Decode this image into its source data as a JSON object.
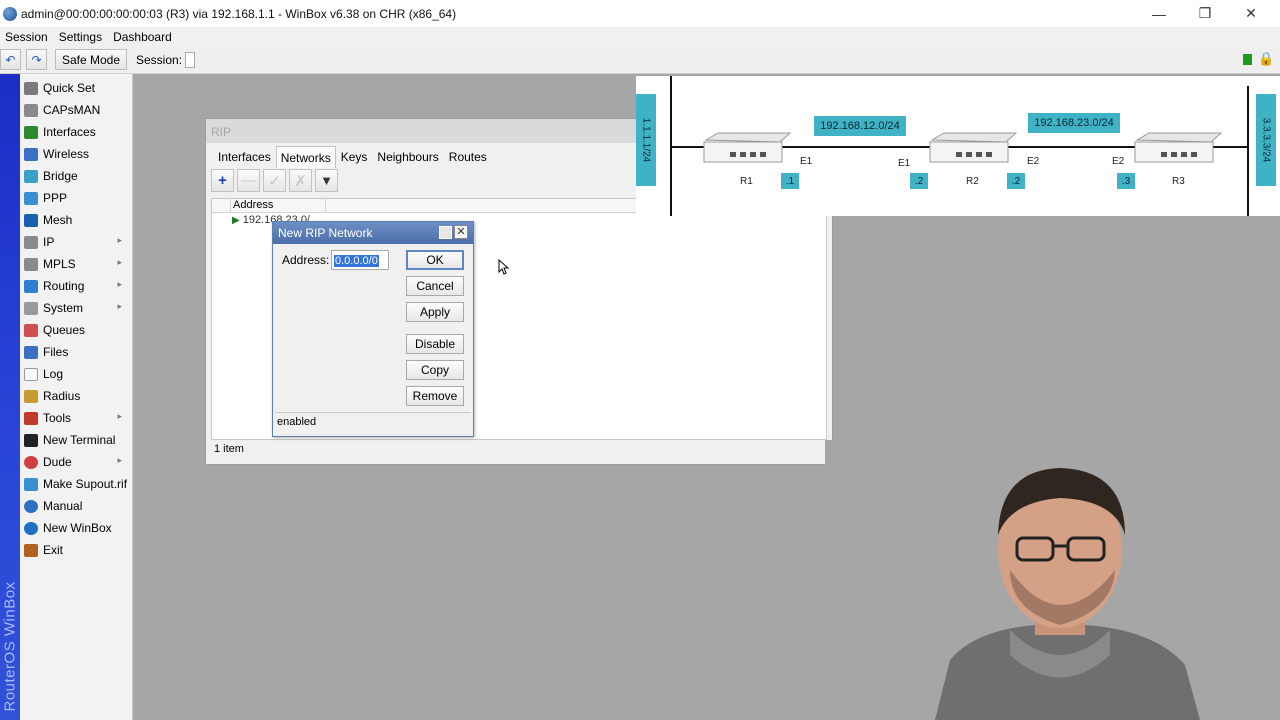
{
  "window": {
    "title": "admin@00:00:00:00:00:03 (R3) via 192.168.1.1 - WinBox v6.38 on CHR (x86_64)",
    "controls": [
      "minimize",
      "restore",
      "close"
    ]
  },
  "menu": [
    "Session",
    "Settings",
    "Dashboard"
  ],
  "toolbar": {
    "undo_icon": "undo-icon",
    "redo_icon": "redo-icon",
    "safe_mode": "Safe Mode",
    "session_label": "Session:"
  },
  "brand": "RouterOS WinBox",
  "sidebar": {
    "items": [
      {
        "label": "Quick Set",
        "icon": "quick-set-icon",
        "color": "#7a7a7a",
        "submenu": false
      },
      {
        "label": "CAPsMAN",
        "icon": "capsman-icon",
        "color": "#8a8a8a",
        "submenu": false
      },
      {
        "label": "Interfaces",
        "icon": "interfaces-icon",
        "color": "#2f8a2f",
        "submenu": false
      },
      {
        "label": "Wireless",
        "icon": "wireless-icon",
        "color": "#3a6fc4",
        "submenu": false
      },
      {
        "label": "Bridge",
        "icon": "bridge-icon",
        "color": "#3aa0c8",
        "submenu": false
      },
      {
        "label": "PPP",
        "icon": "ppp-icon",
        "color": "#3a8fd4",
        "submenu": false
      },
      {
        "label": "Mesh",
        "icon": "mesh-icon",
        "color": "#1b5fb0",
        "submenu": false
      },
      {
        "label": "IP",
        "icon": "ip-icon",
        "color": "#8a8a8a",
        "submenu": true
      },
      {
        "label": "MPLS",
        "icon": "mpls-icon",
        "color": "#8a8a8a",
        "submenu": true
      },
      {
        "label": "Routing",
        "icon": "routing-icon",
        "color": "#2f7fd0",
        "submenu": true
      },
      {
        "label": "System",
        "icon": "system-icon",
        "color": "#9a9a9a",
        "submenu": true
      },
      {
        "label": "Queues",
        "icon": "queues-icon",
        "color": "#d05050",
        "submenu": false
      },
      {
        "label": "Files",
        "icon": "files-icon",
        "color": "#3a6fc4",
        "submenu": false
      },
      {
        "label": "Log",
        "icon": "log-icon",
        "color": "#f2f2f2",
        "submenu": false
      },
      {
        "label": "Radius",
        "icon": "radius-icon",
        "color": "#c89b30",
        "submenu": false
      },
      {
        "label": "Tools",
        "icon": "tools-icon",
        "color": "#c0392b",
        "submenu": true
      },
      {
        "label": "New Terminal",
        "icon": "terminal-icon",
        "color": "#222222",
        "submenu": false
      },
      {
        "label": "Dude",
        "icon": "dude-icon",
        "color": "#d04040",
        "submenu": true
      },
      {
        "label": "Make Supout.rif",
        "icon": "supout-icon",
        "color": "#3a8fd4",
        "submenu": false
      },
      {
        "label": "Manual",
        "icon": "manual-icon",
        "color": "#2f6fc4",
        "submenu": false
      },
      {
        "label": "New WinBox",
        "icon": "winbox-icon",
        "color": "#1f6fc4",
        "submenu": false
      },
      {
        "label": "Exit",
        "icon": "exit-icon",
        "color": "#b06020",
        "submenu": false
      }
    ]
  },
  "rip": {
    "title": "RIP",
    "tabs": [
      "Interfaces",
      "Networks",
      "Keys",
      "Neighbours",
      "Routes"
    ],
    "active_tab": "Networks",
    "column": "Address",
    "row": "192.168.23.0/",
    "status": "1 item"
  },
  "dialog": {
    "title": "New RIP Network",
    "address_label": "Address:",
    "address_value": "0.0.0.0/0",
    "buttons": [
      "OK",
      "Cancel",
      "Apply",
      "Disable",
      "Copy",
      "Remove"
    ],
    "status": "enabled"
  },
  "topology": {
    "left_net": "1.1.1.1/24",
    "right_net": "3.3.3.3/24",
    "net12": "192.168.12.0/24",
    "net23": "192.168.23.0/24",
    "routers": [
      "R1",
      "R2",
      "R3"
    ],
    "ifaces": {
      "r1_e1": "E1",
      "r2_e1": "E1",
      "r2_e2": "E2",
      "r3_e2": "E2"
    },
    "ips": {
      "r1": ".1",
      "r2a": ".2",
      "r2b": ".2",
      "r3": ".3"
    }
  },
  "colors": {
    "accent": "#3fb2c6",
    "winbox_blue": "#2a46d8",
    "dialog_title": "#5a7cb8"
  }
}
